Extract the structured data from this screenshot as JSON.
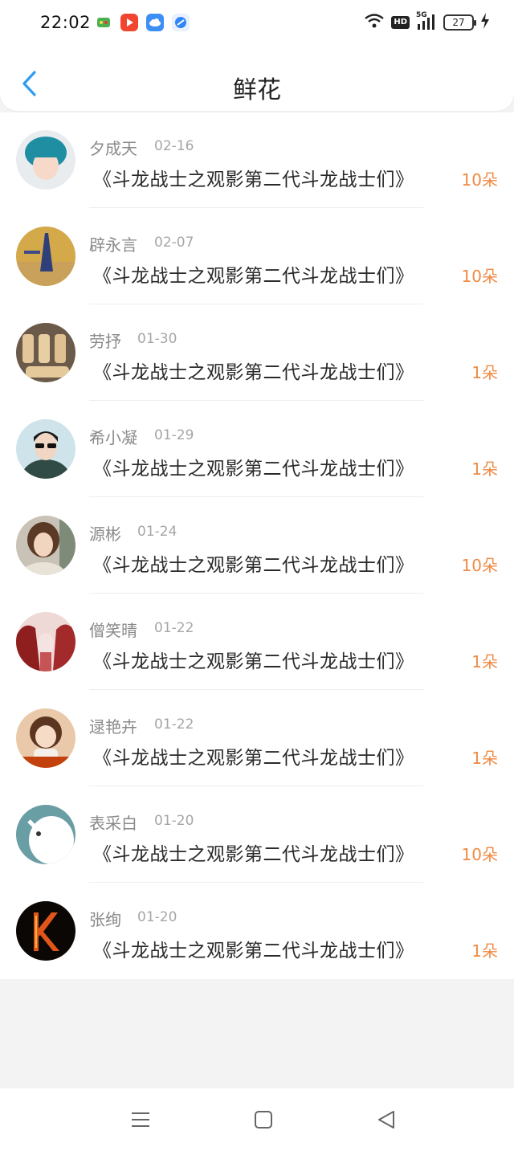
{
  "status_bar": {
    "time": "22:02",
    "hd": "HD",
    "network": "5G",
    "battery": "27",
    "icons": [
      "game-app-icon",
      "video-app-icon",
      "cloud-app-icon",
      "browser-app-icon",
      "wifi-icon",
      "signal-icon",
      "charging-icon"
    ]
  },
  "nav": {
    "title": "鲜花",
    "back_icon": "chevron-left-icon"
  },
  "colors": {
    "accent_back": "#2d9cf2",
    "amount": "#ef8a45"
  },
  "items": [
    {
      "name": "夕成天",
      "date": "02-16",
      "title": "《斗龙战士之观影第二代斗龙战士们》",
      "amount": "10朵",
      "avatar": "blue-hair-avatar"
    },
    {
      "name": "辟永言",
      "date": "02-07",
      "title": "《斗龙战士之观影第二代斗龙战士们》",
      "amount": "10朵",
      "avatar": "tower-avatar"
    },
    {
      "name": "劳抒",
      "date": "01-30",
      "title": "《斗龙战士之观影第二代斗龙战士们》",
      "amount": "1朵",
      "avatar": "wood-blocks-avatar"
    },
    {
      "name": "希小凝",
      "date": "01-29",
      "title": "《斗龙战士之观影第二代斗龙战士们》",
      "amount": "1朵",
      "avatar": "sunglasses-man-avatar"
    },
    {
      "name": "源彬",
      "date": "01-24",
      "title": "《斗龙战士之观影第二代斗龙战士们》",
      "amount": "10朵",
      "avatar": "woman-portrait-avatar"
    },
    {
      "name": "僧笑晴",
      "date": "01-22",
      "title": "《斗龙战士之观影第二代斗龙战士们》",
      "amount": "1朵",
      "avatar": "red-art-avatar"
    },
    {
      "name": "逯艳卉",
      "date": "01-22",
      "title": "《斗龙战士之观影第二代斗龙战士们》",
      "amount": "1朵",
      "avatar": "child-avatar"
    },
    {
      "name": "表采白",
      "date": "01-20",
      "title": "《斗龙战士之观影第二代斗龙战士们》",
      "amount": "10朵",
      "avatar": "white-animal-avatar"
    },
    {
      "name": "张绚",
      "date": "01-20",
      "title": "《斗龙战士之观影第二代斗龙战士们》",
      "amount": "1朵",
      "avatar": "fire-k-avatar"
    }
  ],
  "system_nav": {
    "icons": [
      "menu-icon",
      "home-icon",
      "back-triangle-icon"
    ]
  }
}
